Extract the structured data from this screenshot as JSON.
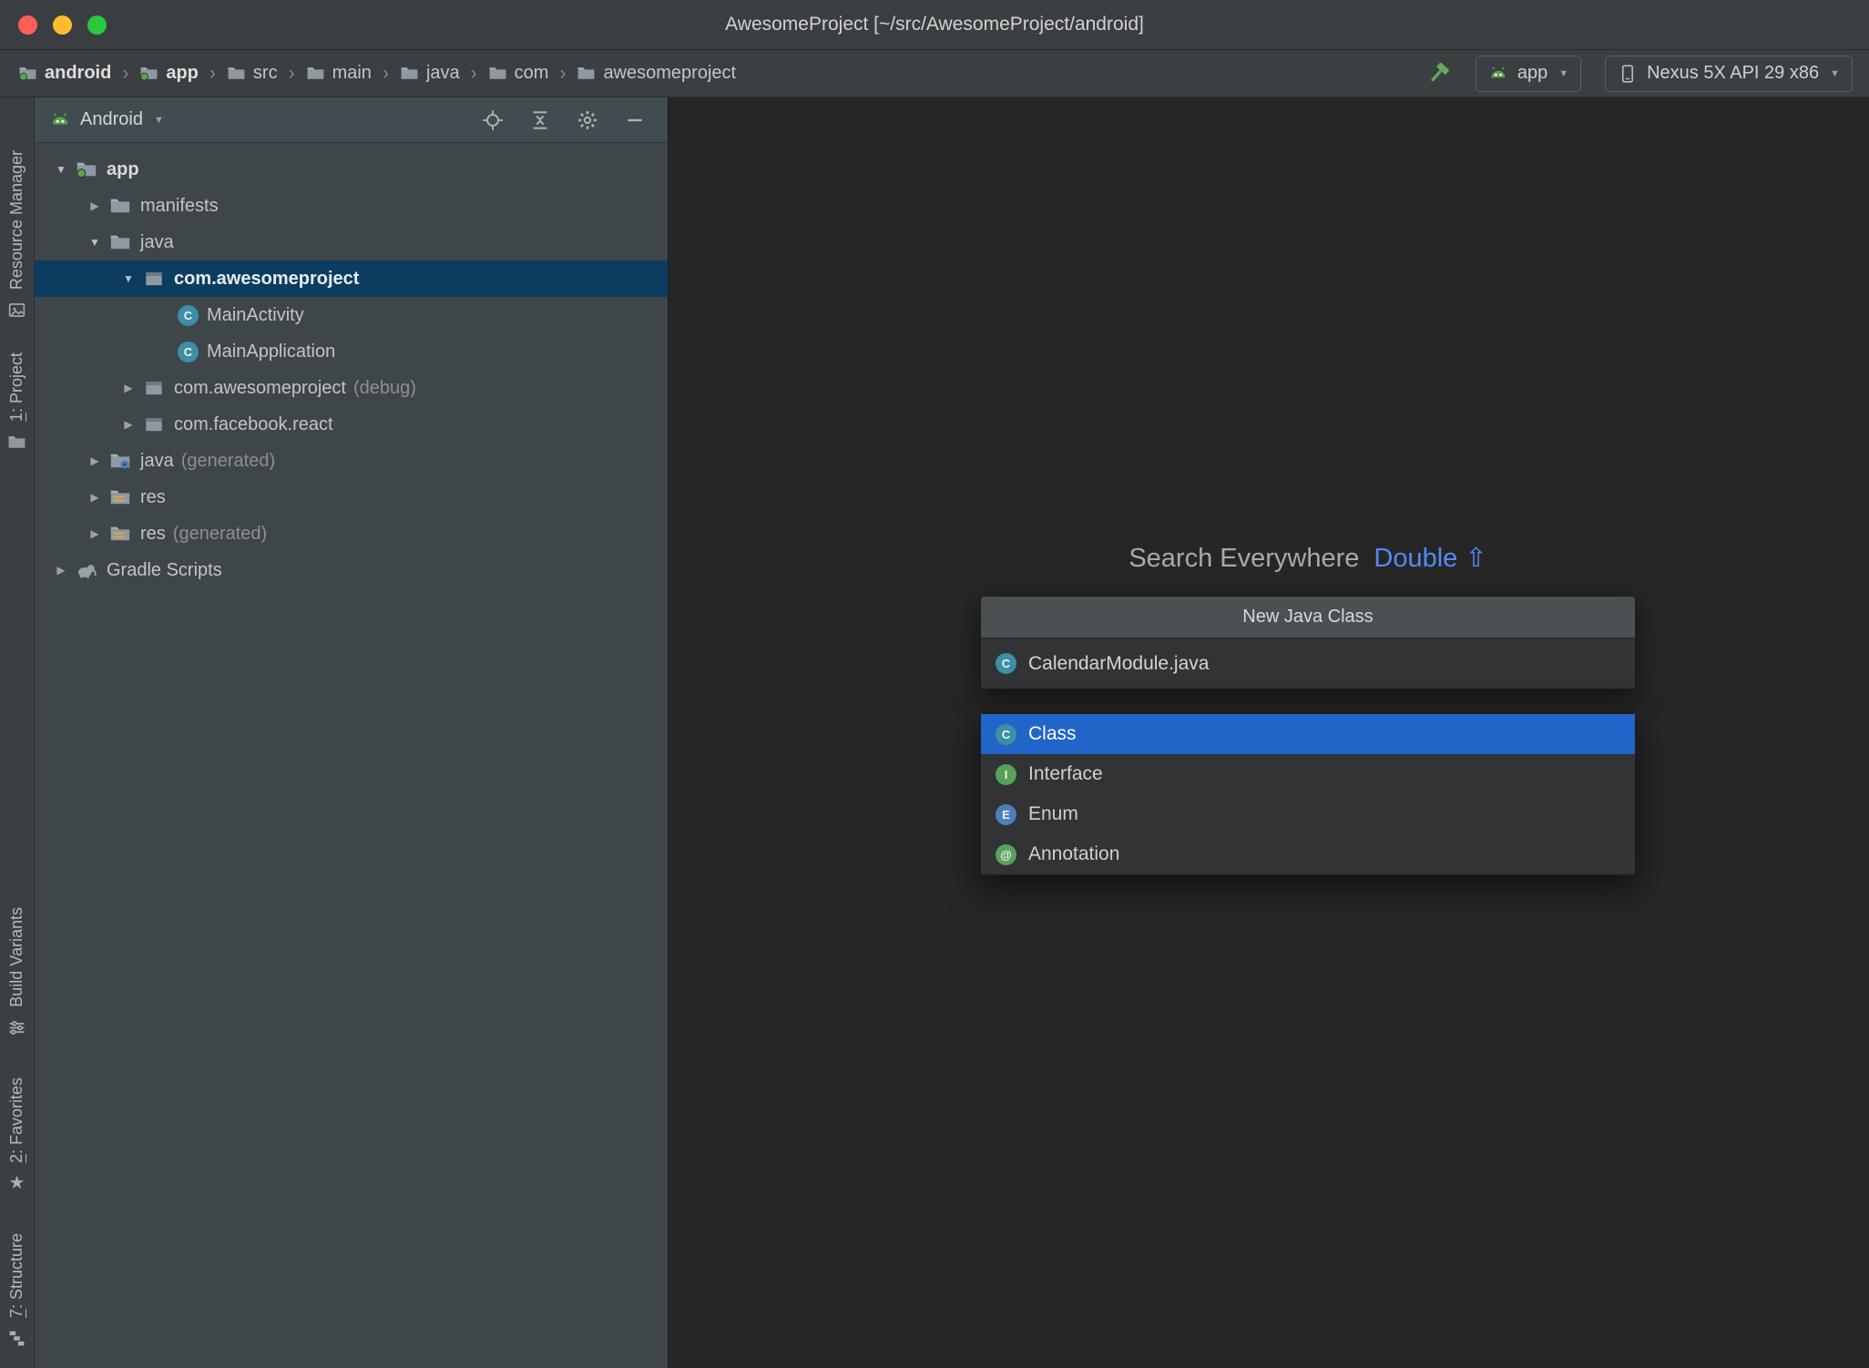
{
  "window": {
    "title": "AwesomeProject [~/src/AwesomeProject/android]"
  },
  "toolbar": {
    "run_config": "app",
    "device": "Nexus 5X API 29 x86"
  },
  "breadcrumbs": [
    {
      "label": "android",
      "icon": "module-folder",
      "bold": true
    },
    {
      "label": "app",
      "icon": "module-folder",
      "bold": true
    },
    {
      "label": "src",
      "icon": "folder"
    },
    {
      "label": "main",
      "icon": "folder"
    },
    {
      "label": "java",
      "icon": "folder"
    },
    {
      "label": "com",
      "icon": "folder"
    },
    {
      "label": "awesomeproject",
      "icon": "folder"
    }
  ],
  "stripe": {
    "top": [
      {
        "label": "Resource Manager",
        "icon": "image"
      },
      {
        "label": "1: Project",
        "icon": "folder",
        "underline_first": true
      }
    ],
    "bottom": [
      {
        "label": "Build Variants",
        "icon": "sliders"
      },
      {
        "label": "2: Favorites",
        "icon": "star",
        "underline_first": true
      },
      {
        "label": "7: Structure",
        "icon": "structure",
        "underline_first": true
      }
    ]
  },
  "project_panel": {
    "view_selector": "Android",
    "tree": [
      {
        "label": "app",
        "indent": 0,
        "arrow": "expanded",
        "icon": "module-folder",
        "bold": true
      },
      {
        "label": "manifests",
        "indent": 1,
        "arrow": "collapsed",
        "icon": "folder"
      },
      {
        "label": "java",
        "indent": 1,
        "arrow": "expanded",
        "icon": "folder"
      },
      {
        "label": "com.awesomeproject",
        "indent": 2,
        "arrow": "expanded",
        "icon": "package",
        "selected": true
      },
      {
        "label": "MainActivity",
        "indent": 3,
        "icon": "class"
      },
      {
        "label": "MainApplication",
        "indent": 3,
        "icon": "class"
      },
      {
        "label": "com.awesomeproject",
        "suffix": "(debug)",
        "indent": 2,
        "arrow": "collapsed",
        "icon": "package"
      },
      {
        "label": "com.facebook.react",
        "indent": 2,
        "arrow": "collapsed",
        "icon": "package"
      },
      {
        "label": "java",
        "suffix": "(generated)",
        "indent": 1,
        "arrow": "collapsed",
        "icon": "generated-folder"
      },
      {
        "label": "res",
        "indent": 1,
        "arrow": "collapsed",
        "icon": "res-folder"
      },
      {
        "label": "res",
        "suffix": "(generated)",
        "indent": 1,
        "arrow": "collapsed",
        "icon": "res-folder"
      },
      {
        "label": "Gradle Scripts",
        "indent": 0,
        "arrow": "collapsed",
        "icon": "gradle"
      }
    ]
  },
  "editor": {
    "hint_text": "Search Everywhere",
    "hint_shortcut": "Double ⇧"
  },
  "popup": {
    "title": "New Java Class",
    "input_value": "CalendarModule.java",
    "input_kind": "C",
    "options": [
      {
        "label": "Class",
        "kind": "C",
        "selected": true
      },
      {
        "label": "Interface",
        "kind": "I"
      },
      {
        "label": "Enum",
        "kind": "E"
      },
      {
        "label": "Annotation",
        "kind": "@"
      }
    ]
  },
  "colors": {
    "tree_selection": "#0d3c61",
    "selection_blue": "#2265c9",
    "hint_link_blue": "#548af7",
    "android_green": "#57a64a",
    "class_icon": "#3c8fa4",
    "interface_icon": "#57a15b",
    "enum_icon": "#4e7fba",
    "annotation_icon": "#57a15b",
    "traffic_red": "#ff5f57",
    "traffic_yellow": "#febc2e",
    "traffic_green": "#28c840"
  }
}
